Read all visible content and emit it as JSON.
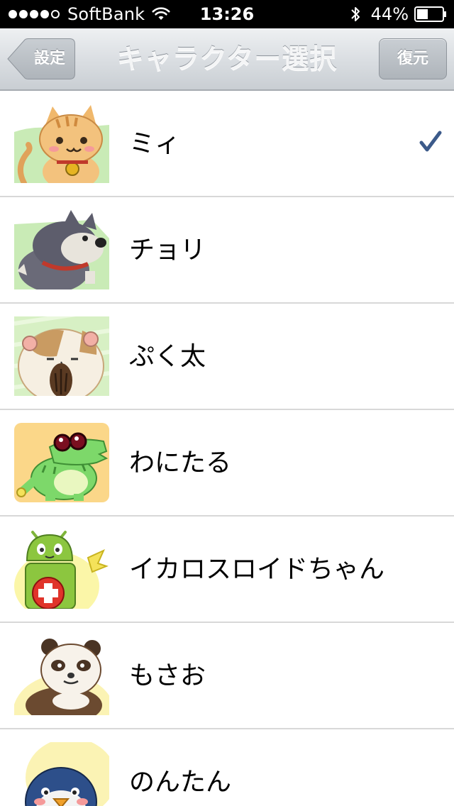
{
  "status_bar": {
    "carrier": "SoftBank",
    "signal_bars_filled": 4,
    "signal_bars_total": 5,
    "time": "13:26",
    "battery_percent": "44%",
    "battery_level": 0.44
  },
  "nav": {
    "back_label": "設定",
    "title": "キャラクター選択",
    "restore_label": "復元"
  },
  "characters": [
    {
      "name": "ミィ",
      "icon": "cat-icon",
      "selected": true
    },
    {
      "name": "チョリ",
      "icon": "dog-icon",
      "selected": false
    },
    {
      "name": "ぷく太",
      "icon": "hamster-icon",
      "selected": false
    },
    {
      "name": "わにたる",
      "icon": "crocodile-icon",
      "selected": false
    },
    {
      "name": "イカロスロイドちゃん",
      "icon": "android-icon",
      "selected": false
    },
    {
      "name": "もさお",
      "icon": "panda-icon",
      "selected": false
    },
    {
      "name": "のんたん",
      "icon": "penguin-icon",
      "selected": false
    }
  ],
  "colors": {
    "checkmark": "#3c5a8a",
    "status_bar_bg": "#000000",
    "nav_bar_bg": "#d9dde1"
  }
}
